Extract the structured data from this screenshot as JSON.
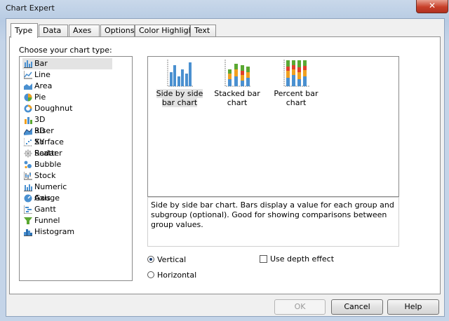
{
  "window": {
    "title": "Chart Expert",
    "close_label": "✕"
  },
  "tabs": [
    {
      "label": "Type",
      "active": true
    },
    {
      "label": "Data"
    },
    {
      "label": "Axes"
    },
    {
      "label": "Options"
    },
    {
      "label": "Color Highlight"
    },
    {
      "label": "Text"
    }
  ],
  "choose_label": "Choose your chart type:",
  "chart_types": [
    {
      "label": "Bar",
      "icon": "bar-chart-icon",
      "selected": true
    },
    {
      "label": "Line",
      "icon": "line-chart-icon"
    },
    {
      "label": "Area",
      "icon": "area-chart-icon"
    },
    {
      "label": "Pie",
      "icon": "pie-chart-icon"
    },
    {
      "label": "Doughnut",
      "icon": "doughnut-chart-icon"
    },
    {
      "label": "3D Riser",
      "icon": "3d-riser-icon"
    },
    {
      "label": "3D Surface",
      "icon": "3d-surface-icon"
    },
    {
      "label": "XY Scatter",
      "icon": "xy-scatter-icon"
    },
    {
      "label": "Radar",
      "icon": "radar-chart-icon"
    },
    {
      "label": "Bubble",
      "icon": "bubble-chart-icon"
    },
    {
      "label": "Stock",
      "icon": "stock-chart-icon"
    },
    {
      "label": "Numeric Axis",
      "icon": "numeric-axis-icon"
    },
    {
      "label": "Gauge",
      "icon": "gauge-chart-icon"
    },
    {
      "label": "Gantt",
      "icon": "gantt-chart-icon"
    },
    {
      "label": "Funnel",
      "icon": "funnel-chart-icon"
    },
    {
      "label": "Histogram",
      "icon": "histogram-chart-icon"
    }
  ],
  "subtypes": [
    {
      "label": "Side by side bar chart",
      "icon": "side-by-side-bar-icon",
      "selected": true
    },
    {
      "label": "Stacked bar chart",
      "icon": "stacked-bar-icon"
    },
    {
      "label": "Percent bar chart",
      "icon": "percent-bar-icon"
    }
  ],
  "description": "Side by side bar chart. Bars display a value for each group and subgroup (optional). Good for showing comparisons between group values.",
  "orientation": {
    "vertical": "Vertical",
    "horizontal": "Horizontal",
    "selected": "vertical"
  },
  "depth_effect": {
    "label": "Use depth effect",
    "checked": false
  },
  "buttons": {
    "ok": "OK",
    "cancel": "Cancel",
    "help": "Help"
  },
  "colors": {
    "bar_blue": "#4a90d0",
    "bar_green": "#5aa832",
    "bar_orange": "#f0a020",
    "bar_red": "#e0402a"
  }
}
